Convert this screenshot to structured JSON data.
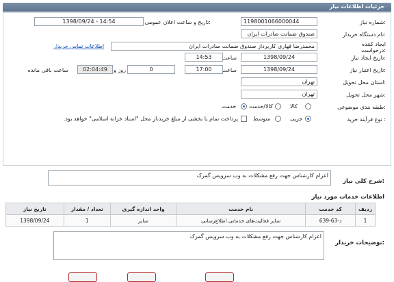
{
  "header": {
    "title": "جزئیات اطلاعات نیاز"
  },
  "form": {
    "need_number_label": "شماره نیاز:",
    "need_number": "1198001066000044",
    "announce_label": "تاریخ و ساعت اعلان عمومی:",
    "announce_value": "1398/09/24 - 14:54",
    "buyer_org_label": "نام دستگاه خریدار:",
    "buyer_org": "صندوق ضمانت صادرات ایران",
    "requester_label": "ایجاد کننده درخواست:",
    "requester": "محمدرضا قهاری کاربرداز صندوق ضمانت صادرات ایران",
    "contact_link": "اطلاعات تماس خریدار",
    "created_label": "تاریخ ایجاد نیاز:",
    "created_date": "1398/09/24",
    "time_word": "ساعت",
    "created_time": "14:53",
    "deadline_label": "تاریخ اعتبار نیاز:",
    "deadline_date": "1398/09/24",
    "deadline_time": "17:00",
    "days_value": "0",
    "day_word": "روز و",
    "remaining_time": "02:04:49",
    "remaining_label": "ساعت باقی مانده",
    "province_label": "استان محل تحویل:",
    "province": "تهران",
    "city_label": "شهر محل تحویل:",
    "city": "تهران",
    "category_label": "طبقه بندی موضوعی:",
    "category_options": [
      "کالا",
      "کالا/خدمت",
      "خدمت"
    ],
    "purchase_label": "نوع فرآیند خرید :",
    "purchase_options": [
      "جزیی",
      "متوسط"
    ],
    "payment_note": "پرداخت تمام یا بخشی از مبلغ خرید،از محل \"اسناد خزانه اسلامی\" خواهد بود."
  },
  "summary": {
    "label": "شرح کلی نیاز:",
    "text": "اعزام کارشناس جهت رفع مشکلات به وب سرویس گمرک"
  },
  "services": {
    "section_title": "اطلاعات خدمات مورد نیاز",
    "columns": [
      "ردیف",
      "کد خدمت",
      "نام خدمت",
      "واحد اندازه گیری",
      "تعداد / مقدار",
      "تاریخ نیاز"
    ],
    "rows": [
      [
        "1",
        "د-63-639",
        "سایر فعالیت‌های خدماتی اطلاع‌رسانی",
        "سایر",
        "1",
        "1398/09/24"
      ]
    ]
  },
  "buyer_notes": {
    "label": "توضیحات خریدار:",
    "text": "اعزام کارشناس جهت رفع مشکلات به وب سرویس گمرک"
  }
}
